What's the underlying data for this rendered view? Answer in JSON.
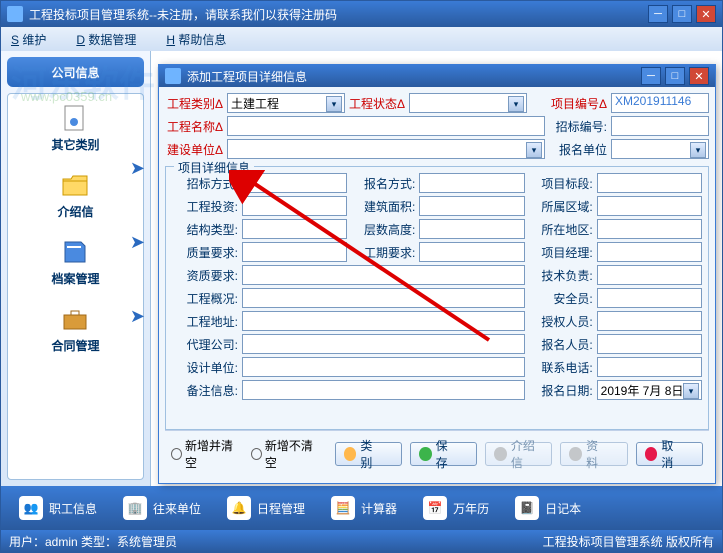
{
  "window": {
    "title": "工程投标项目管理系统--未注册，请联系我们以获得注册码",
    "watermark": "河东软件园",
    "watermark_url": "www.pc0359.cn"
  },
  "menu": {
    "maintain": "S 维护",
    "data": "D 数据管理",
    "help": "H 帮助信息"
  },
  "sidebar": {
    "header": "公司信息",
    "items": [
      {
        "label": "其它类别"
      },
      {
        "label": "介绍信"
      },
      {
        "label": "档案管理"
      },
      {
        "label": "合同管理"
      }
    ]
  },
  "dialog": {
    "title": "添加工程项目详细信息",
    "row1": {
      "type_label": "工程类别",
      "type_value": "土建工程",
      "status_label": "工程状态",
      "status_value": "",
      "number_label": "项目编号",
      "number_value": "XM201911146"
    },
    "row2": {
      "name_label": "工程名称",
      "bid_number_label": "招标编号:"
    },
    "row3": {
      "unit_label": "建设单位",
      "apply_unit_label": "报名单位"
    },
    "fieldset_legend": "项目详细信息",
    "fields": {
      "bid_method": "招标方式:",
      "apply_method": "报名方式:",
      "section": "项目标段:",
      "investment": "工程投资:",
      "area": "建筑面积:",
      "region": "所属区域:",
      "structure": "结构类型:",
      "floors": "层数高度:",
      "location": "所在地区:",
      "quality": "质量要求:",
      "duration": "工期要求:",
      "manager": "项目经理:",
      "qualification": "资质要求:",
      "tech_lead": "技术负责:",
      "overview": "工程概况:",
      "safety_officer": "安全员:",
      "address": "工程地址:",
      "auth_person": "授权人员:",
      "agency": "代理公司:",
      "applicant": "报名人员:",
      "design_unit": "设计单位:",
      "phone": "联系电话:",
      "remark": "备注信息:",
      "apply_date": "报名日期:",
      "apply_date_value": "2019年 7月 8日"
    },
    "footer": {
      "radio1": "新增并清空",
      "radio2": "新增不清空",
      "btn_category": "类　别",
      "btn_save": "保　存",
      "btn_intro": "介绍信",
      "btn_material": "资　料",
      "btn_cancel": "取　消"
    }
  },
  "toolbar": {
    "staff": "职工信息",
    "units": "往来单位",
    "schedule": "日程管理",
    "calculator": "计算器",
    "calendar": "万年历",
    "diary": "日记本"
  },
  "status": {
    "left": "用户：admin  类型：系统管理员",
    "right": "工程投标项目管理系统  版权所有"
  }
}
